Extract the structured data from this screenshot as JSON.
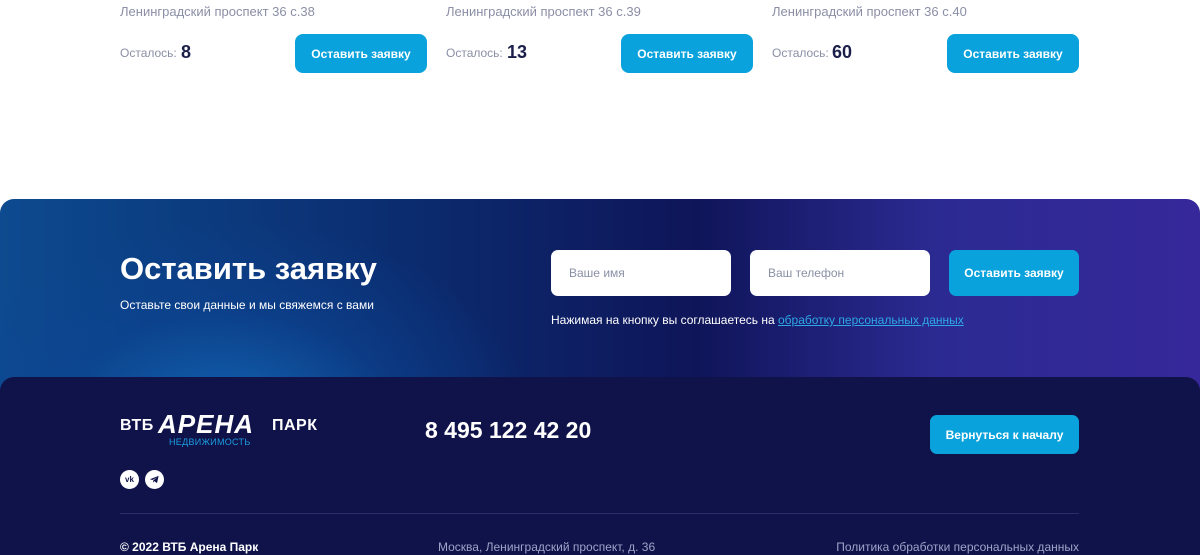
{
  "cards": [
    {
      "address": "Ленинградский проспект 36 с.38",
      "left_label": "Осталось:",
      "left_count": "8",
      "button_label": "Оставить заявку"
    },
    {
      "address": "Ленинградский проспект 36 с.39",
      "left_label": "Осталось:",
      "left_count": "13",
      "button_label": "Оставить заявку"
    },
    {
      "address": "Ленинградский проспект 36 с.40",
      "left_label": "Осталось:",
      "left_count": "60",
      "button_label": "Оставить заявку"
    }
  ],
  "request": {
    "title": "Оставить заявку",
    "subtitle": "Оставьте свои данные и мы свяжемся с вами",
    "name_placeholder": "Ваше имя",
    "phone_placeholder": "Ваш телефон",
    "name_value": "",
    "phone_value": "",
    "submit_label": "Оставить заявку",
    "consent_text": "Нажимая на кнопку вы соглашаетесь на ",
    "consent_link": "обработку персональных данных"
  },
  "footer": {
    "logo": {
      "vtb": "ВТБ",
      "arena": "АРЕНА",
      "park": "ПАРК",
      "subtitle": "НЕДВИЖИМОСТЬ"
    },
    "phone": "8 495 122 42 20",
    "back_label": "Вернуться к началу",
    "social": [
      {
        "icon": "vk-icon",
        "label": "vk"
      },
      {
        "icon": "telegram-icon",
        "label": "➤"
      }
    ],
    "copyright": "© 2022 ВТБ Арена Парк",
    "address": "Москва, Ленинградский проспект, д. 36",
    "policy": "Политика обработки персональных данных"
  },
  "colors": {
    "accent": "#0aa2dc",
    "footer_bg": "#10134a",
    "text_muted": "#8a8fa6",
    "link": "#2ea8e6"
  }
}
